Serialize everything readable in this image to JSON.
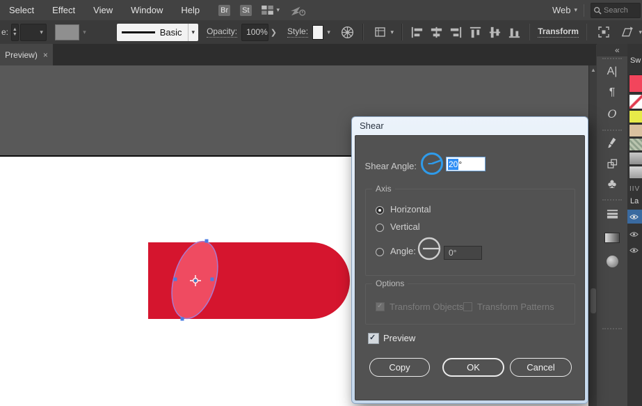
{
  "menubar": {
    "items": [
      "Select",
      "Effect",
      "View",
      "Window",
      "Help"
    ],
    "br_badge": "Br",
    "st_badge": "St",
    "workspace_label": "Web",
    "search_placeholder": "Search"
  },
  "controlbar": {
    "stroke_label_partial": "e:",
    "brush_name": "Basic",
    "opacity_label": "Opacity:",
    "opacity_value": "100%",
    "opacity_arrow": "❯",
    "style_label": "Style:",
    "transform_label": "Transform"
  },
  "tabbar": {
    "tab_label": "Preview)",
    "close_glyph": "×"
  },
  "canvas": {
    "rect_css": "background:#d5152e",
    "ellipse_fill": "#ef4b61",
    "ellipse_stroke": "#a87bd0",
    "anchor_color": "#4a7de2"
  },
  "dock": {
    "collapse_glyph": "«",
    "swatches_title": "Sw",
    "swatches": [
      {
        "name": "red",
        "css": "background:#f2455c"
      },
      {
        "name": "none",
        "css": "background:linear-gradient(135deg,#ffffff 42%,#e03a4e 47%,#e03a4e 56%,#ffffff 61%)"
      },
      {
        "name": "yellow-green",
        "css": "background:#e7ea49"
      },
      {
        "name": "tan",
        "css": "background:#d9c09f"
      },
      {
        "name": "pattern",
        "css": "background:repeating-linear-gradient(45deg,#b9c4ae 0 3px,#8fa08b 3px 6px)"
      },
      {
        "name": "gray-1",
        "css": "background:linear-gradient(#c8c8c8,#8f8f8f)"
      },
      {
        "name": "gray-2",
        "css": "background:linear-gradient(#d6d6d6,#9e9e9e)"
      }
    ],
    "swatches_footer": "IIV",
    "layers_title": "La"
  },
  "dialog": {
    "title": "Shear",
    "shear_angle_label": "Shear Angle:",
    "angle_selected": "20",
    "angle_suffix": "°",
    "axis_group_label": "Axis",
    "radio_horizontal": "Horizontal",
    "radio_vertical": "Vertical",
    "radio_angle": "Angle:",
    "axis_angle_value": "0°",
    "options_group_label": "Options",
    "cb_objects_label": "Transform Objects",
    "cb_patterns_label": "Transform Patterns",
    "preview_label": "Preview",
    "copy_label": "Copy",
    "ok_label": "OK",
    "cancel_label": "Cancel"
  }
}
